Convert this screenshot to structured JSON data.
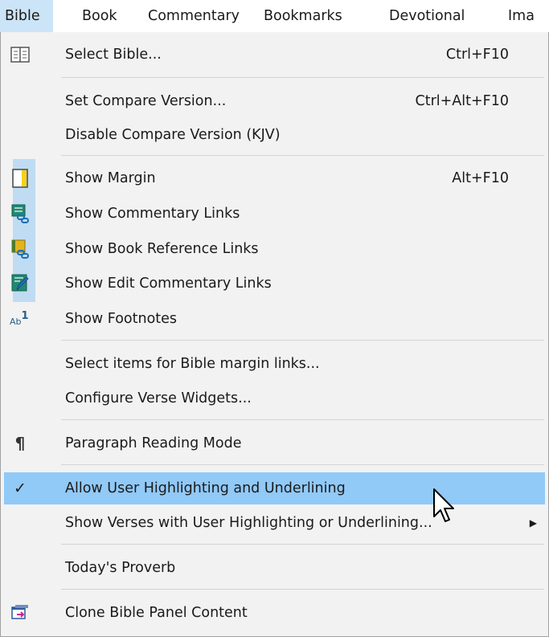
{
  "menubar": {
    "items": [
      {
        "label": "Bible"
      },
      {
        "label": "Book"
      },
      {
        "label": "Commentary"
      },
      {
        "label": "Bookmarks"
      },
      {
        "label": "Devotional"
      },
      {
        "label": "Ima"
      }
    ]
  },
  "menu": {
    "select_bible": {
      "label": "Select Bible...",
      "shortcut": "Ctrl+F10",
      "icon": "book-open-icon"
    },
    "set_compare": {
      "label": "Set Compare Version...",
      "shortcut": "Ctrl+Alt+F10"
    },
    "disable_compare": {
      "label": "Disable Compare Version (KJV)"
    },
    "show_margin": {
      "label": "Show Margin",
      "shortcut": "Alt+F10",
      "icon": "margin-icon"
    },
    "show_commentary_links": {
      "label": "Show Commentary Links",
      "icon": "commentary-link-icon"
    },
    "show_book_reference_links": {
      "label": "Show Book Reference Links",
      "icon": "book-link-icon"
    },
    "show_edit_commentary_links": {
      "label": "Show Edit Commentary Links",
      "icon": "edit-commentary-icon"
    },
    "show_footnotes": {
      "label": "Show Footnotes",
      "icon": "footnote-icon",
      "icon_text": "Ab",
      "icon_sup": "1"
    },
    "select_margin_items": {
      "label": "Select items for Bible margin links..."
    },
    "configure_widgets": {
      "label": "Configure Verse Widgets..."
    },
    "paragraph_mode": {
      "label": "Paragraph Reading Mode",
      "icon": "pilcrow-icon",
      "glyph": "¶"
    },
    "allow_highlighting": {
      "label": "Allow User Highlighting and Underlining",
      "icon": "checkmark-icon",
      "glyph": "✓",
      "checked": true
    },
    "show_verses_highlighting": {
      "label": "Show Verses with User Highlighting or Underlining...",
      "submenu_glyph": "▶"
    },
    "todays_proverb": {
      "label": "Today's Proverb"
    },
    "clone_panel": {
      "label": "Clone Bible Panel Content",
      "icon": "clone-panel-icon"
    }
  },
  "colors": {
    "active_menu": "#cce4f7",
    "hover_row": "#91c9f7",
    "icon_column_checked": "#bfdcf3",
    "menu_bg": "#f2f2f2"
  }
}
